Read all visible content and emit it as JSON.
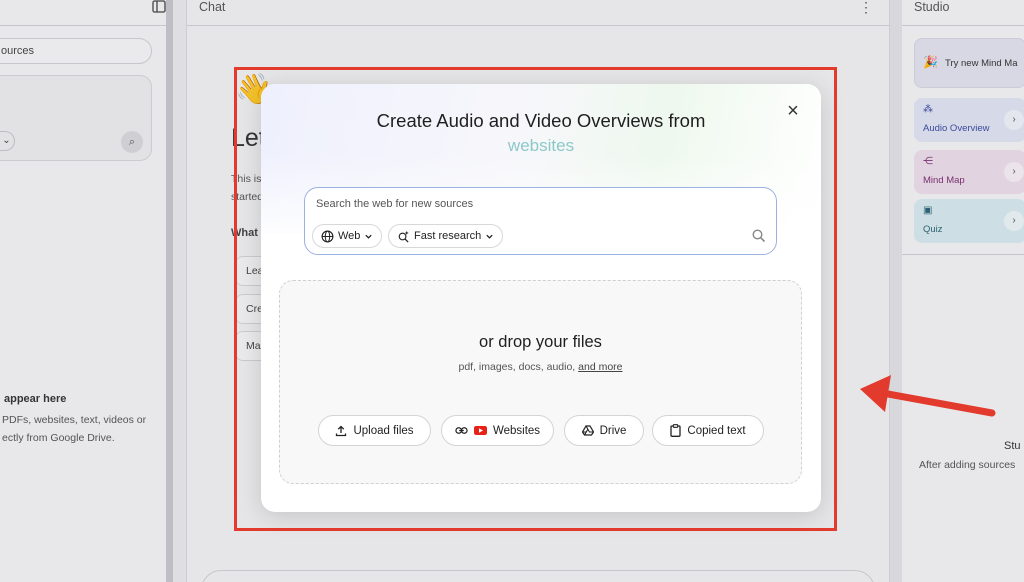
{
  "left_panel": {
    "search_text": "ources",
    "empty_title": "appear here",
    "empty_text_1": "PDFs, websites, text, videos or",
    "empty_text_2": "ectly from Google Drive."
  },
  "chat_panel": {
    "title": "Chat",
    "heading": "Let",
    "intro_1": "This is",
    "intro_2": "started",
    "what": "What",
    "suggestions": [
      "Lea",
      "Cre",
      "Ma"
    ]
  },
  "studio": {
    "title": "Studio",
    "try_label": "Try new Mind Ma",
    "buttons": [
      {
        "label": "Audio Overview",
        "color": "#dfe3f3"
      },
      {
        "label": "Mind Map",
        "color": "#ecdcea"
      },
      {
        "label": "Quiz",
        "color": "#d6e9ef"
      }
    ],
    "stu": "Stu",
    "after": "After adding sources"
  },
  "modal": {
    "title": "Create Audio and Video Overviews from",
    "subtitle": "websites",
    "close": "×",
    "search": {
      "placeholder": "Search the web for new sources",
      "web_chip": "Web",
      "research_chip": "Fast research"
    },
    "drop": {
      "title": "or drop your files",
      "types": "pdf, images, docs, audio,",
      "more_link": "and more"
    },
    "buttons": {
      "upload": "Upload files",
      "websites": "Websites",
      "drive": "Drive",
      "copied": "Copied text"
    }
  },
  "colors": {
    "highlight": "#e23b2e",
    "arrow": "#e23b2e",
    "search_border": "#9bb0e3",
    "youtube": "#e62117"
  }
}
